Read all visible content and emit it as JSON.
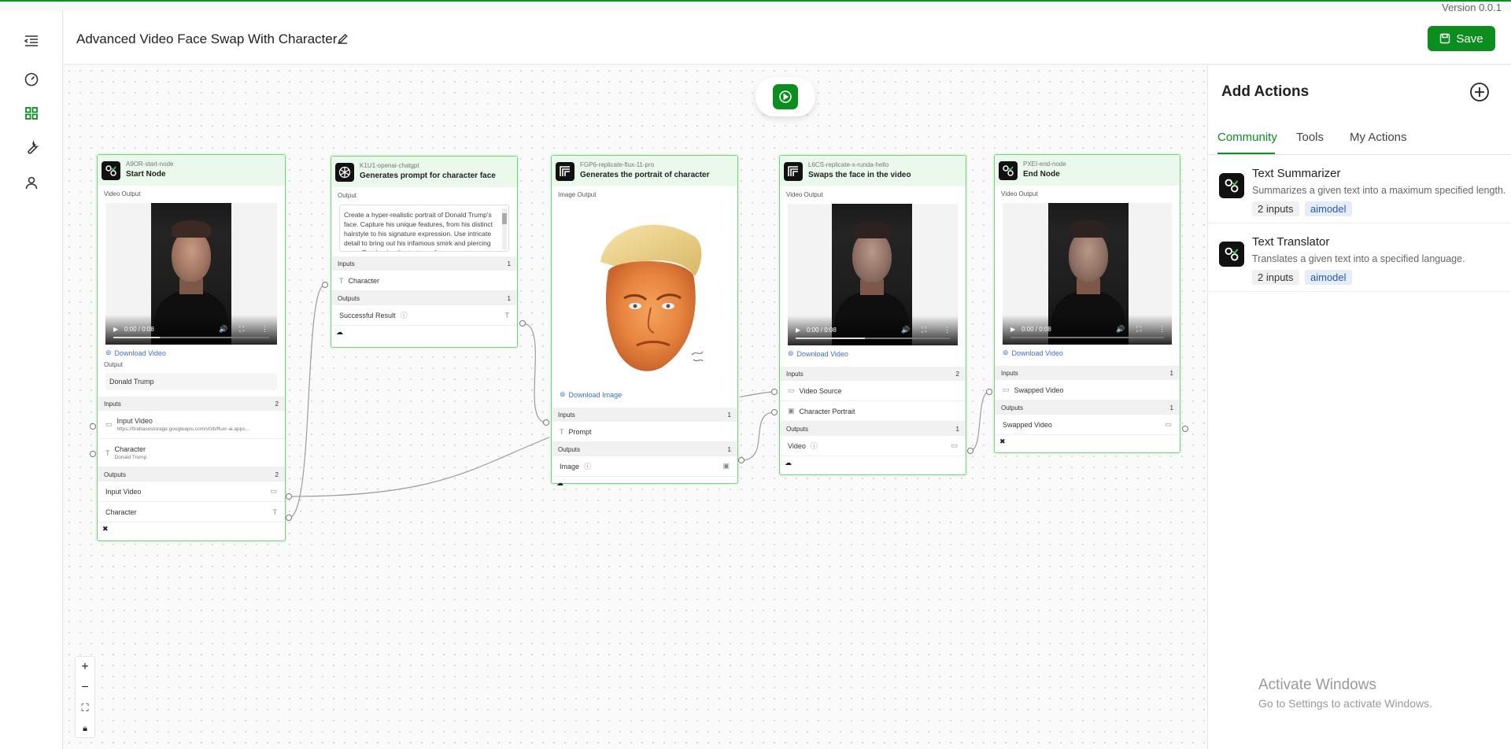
{
  "version": "Version 0.0.1",
  "header": {
    "title": "Advanced Video Face Swap With Character",
    "save_label": "Save"
  },
  "colors": {
    "accent": "#0a8f1e",
    "node_border": "#6fd47a",
    "link": "#3b6fd6"
  },
  "rail": {
    "icons": [
      "menu-collapse-icon",
      "dashboard-icon",
      "grid-icon",
      "wrench-icon",
      "user-icon"
    ]
  },
  "nodes": {
    "start": {
      "id": "A9OR-start-node",
      "name": "Start Node",
      "video_output_label": "Video Output",
      "video_time": "0:00 / 0:08",
      "video_progress": 0.3,
      "download": "Download Video",
      "output_label": "Output",
      "output_value": "Donald Trump",
      "inputs_label": "Inputs",
      "inputs_count": "2",
      "inputs": [
        {
          "label": "Input Video",
          "sub": "https://firebasestorage.googleapis.com/v0/b/fluxr-ai.apps..."
        },
        {
          "label": "Character",
          "sub": "Donald Trump"
        }
      ],
      "outputs_label": "Outputs",
      "outputs_count": "2",
      "outputs": [
        {
          "label": "Input Video"
        },
        {
          "label": "Character"
        }
      ]
    },
    "chatgpt": {
      "id": "K1U1-openai-chatgpt",
      "name": "Generates prompt for character face",
      "output_label": "Output",
      "output_text": "Create a hyper-realistic portrait of Donald Trump's face. Capture his unique features, from his distinct hairstyle to his signature expression. Use intricate detail to bring out his infamous smirk and piercing gaze. Emphasize the texture of",
      "inputs_label": "Inputs",
      "inputs_count": "1",
      "input": "Character",
      "outputs_label": "Outputs",
      "outputs_count": "1",
      "output": "Successful Result"
    },
    "flux": {
      "id": "FGP6-replicate-flux-11-pro",
      "name": "Generates the portrait of character",
      "image_output_label": "Image Output",
      "download": "Download Image",
      "inputs_label": "Inputs",
      "inputs_count": "1",
      "input": "Prompt",
      "outputs_label": "Outputs",
      "outputs_count": "1",
      "output": "Image"
    },
    "swap": {
      "id": "L6CS-replicate-x-runda-hello",
      "name": "Swaps the face in the video",
      "video_output_label": "Video Output",
      "video_time": "0:00 / 0:08",
      "video_progress": 0.45,
      "download": "Download Video",
      "inputs_label": "Inputs",
      "inputs_count": "2",
      "inputs": [
        {
          "label": "Video Source"
        },
        {
          "label": "Character Portrait"
        }
      ],
      "outputs_label": "Outputs",
      "outputs_count": "1",
      "output": "Video"
    },
    "end": {
      "id": "PXEI-end-node",
      "name": "End Node",
      "video_output_label": "Video Output",
      "video_time": "0:00 / 0:08",
      "video_progress": 0.0,
      "download": "Download Video",
      "inputs_label": "Inputs",
      "inputs_count": "1",
      "input": "Swapped Video",
      "outputs_label": "Outputs",
      "outputs_count": "1",
      "output": "Swapped Video"
    }
  },
  "panel": {
    "title": "Add Actions",
    "tabs": [
      "Community",
      "Tools",
      "My Actions"
    ],
    "active_tab": "Community",
    "actions": [
      {
        "name": "Text Summarizer",
        "desc": "Summarizes a given text into a maximum specified length.",
        "inputs": "2 inputs",
        "tag": "aimodel"
      },
      {
        "name": "Text Translator",
        "desc": "Translates a given text into a specified language.",
        "inputs": "2 inputs",
        "tag": "aimodel"
      }
    ]
  },
  "watermark": {
    "line1": "Activate Windows",
    "line2": "Go to Settings to activate Windows."
  },
  "zoom_controls": [
    "zoom-in",
    "zoom-out",
    "fit-view",
    "lock"
  ]
}
